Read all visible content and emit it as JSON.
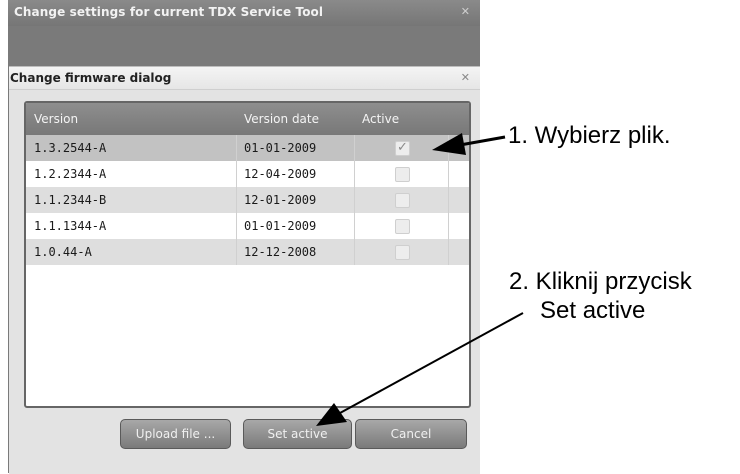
{
  "outer_window": {
    "title": "Change settings for current TDX Service Tool",
    "close_glyph": "✕"
  },
  "dialog": {
    "title": "Change firmware dialog",
    "close_glyph": "✕"
  },
  "grid": {
    "columns": [
      "Version",
      "Version date",
      "Active"
    ],
    "rows": [
      {
        "version": "1.3.2544-A",
        "date": "01-01-2009",
        "active": true
      },
      {
        "version": "1.2.2344-A",
        "date": "12-04-2009",
        "active": false
      },
      {
        "version": "1.1.2344-B",
        "date": "12-01-2009",
        "active": false
      },
      {
        "version": "1.1.1344-A",
        "date": "01-01-2009",
        "active": false
      },
      {
        "version": "1.0.44-A",
        "date": "12-12-2008",
        "active": false
      }
    ]
  },
  "buttons": {
    "upload": "Upload file ...",
    "set_active": "Set active",
    "cancel": "Cancel"
  },
  "annotations": {
    "step1": "1.  Wybierz plik.",
    "step2_line1": "2. Kliknij przycisk",
    "step2_line2": "Set active"
  }
}
